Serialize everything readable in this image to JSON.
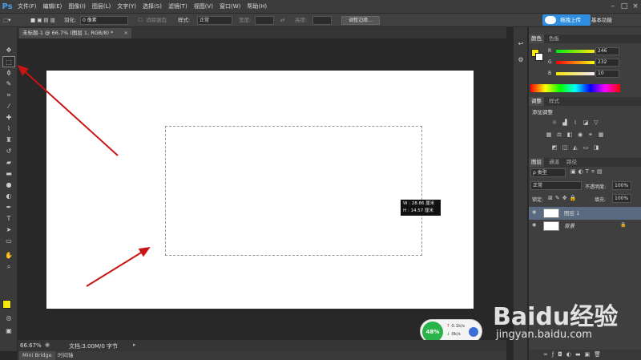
{
  "app": {
    "logo": "Ps"
  },
  "menu": [
    "文件(F)",
    "编辑(E)",
    "图像(I)",
    "图层(L)",
    "文字(Y)",
    "选择(S)",
    "滤镜(T)",
    "视图(V)",
    "窗口(W)",
    "帮助(H)"
  ],
  "options": {
    "feather_label": "羽化:",
    "feather_value": "0 像素",
    "antialias_label": "消除锯齿",
    "style_label": "样式:",
    "style_value": "正常",
    "width_label": "宽度:",
    "height_label": "高度:",
    "refine_edge": "调整边缘..."
  },
  "cloud": {
    "upload_label": "拖拽上传"
  },
  "workspace": {
    "name": "基本功能"
  },
  "document": {
    "tab_title": "未标题-1 @ 66.7% (图层 1, RGB/8) *"
  },
  "selection_tip": {
    "w": "W : 28.86 厘米",
    "h": "H : 14.57 厘米"
  },
  "net": {
    "percent": "48%",
    "up": "0.1k/s",
    "down": "0k/s"
  },
  "status": {
    "zoom": "66.67%",
    "doc_info": "文档:3.00M/0 字节"
  },
  "bottom_tabs": [
    "Mini Bridge",
    "时间轴"
  ],
  "color_panel": {
    "tabs": [
      "颜色",
      "色板"
    ],
    "r_label": "R",
    "r_value": "246",
    "g_label": "G",
    "g_value": "232",
    "b_label": "B",
    "b_value": "10",
    "foreground": "#f6e80a"
  },
  "adjust_panel": {
    "tabs": [
      "调整",
      "样式"
    ],
    "title": "添加调整"
  },
  "layers_panel": {
    "tabs": [
      "图层",
      "通道",
      "路径"
    ],
    "filter_label": "ρ 类型",
    "blend_mode": "正常",
    "opacity_label": "不透明度:",
    "opacity_value": "100%",
    "lock_label": "锁定:",
    "fill_label": "填充:",
    "fill_value": "100%",
    "layers": [
      {
        "name": "图层 1"
      },
      {
        "name": "背景"
      }
    ]
  },
  "watermark": {
    "brand": "Baidu经验",
    "url": "jingyan.baidu.com"
  }
}
